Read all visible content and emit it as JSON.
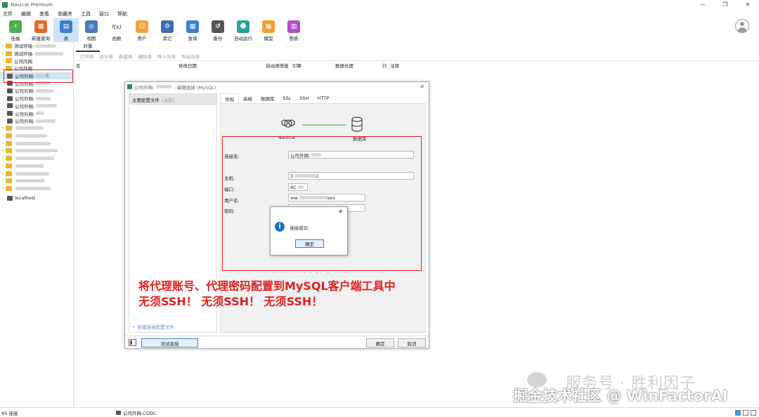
{
  "window": {
    "title": "Navicat Premium",
    "controls": [
      "—",
      "❐",
      "✕"
    ]
  },
  "menu": [
    "文件",
    "编辑",
    "查看",
    "收藏夹",
    "工具",
    "窗口",
    "帮助"
  ],
  "toolbar": [
    {
      "label": "连接",
      "icon": "connect-icon",
      "color": "#4caf50",
      "glyph": "⚡"
    },
    {
      "label": "新建查询",
      "icon": "new-query-icon",
      "color": "#e8682a",
      "glyph": "▦"
    },
    {
      "label": "表",
      "icon": "table-icon",
      "color": "#3b7fd4",
      "glyph": "▤",
      "active": true
    },
    {
      "label": "视图",
      "icon": "view-icon",
      "color": "#4a7ab8",
      "glyph": "◎"
    },
    {
      "label": "函数",
      "icon": "function-icon",
      "color": "#ffffff",
      "glyph": "f(x)"
    },
    {
      "label": "用户",
      "icon": "user-icon",
      "color": "#f2a33a",
      "glyph": "☺"
    },
    {
      "label": "其它",
      "icon": "tools-icon",
      "color": "#3d6fb0",
      "glyph": "⚙"
    },
    {
      "label": "查询",
      "icon": "query-icon",
      "color": "#3b7fd4",
      "glyph": "▦"
    },
    {
      "label": "备份",
      "icon": "backup-icon",
      "color": "#555555",
      "glyph": "↺"
    },
    {
      "label": "自动运行",
      "icon": "robot-icon",
      "color": "#29a19c",
      "glyph": "☻"
    },
    {
      "label": "模型",
      "icon": "model-icon",
      "color": "#f0a030",
      "glyph": "▣"
    },
    {
      "label": "图表",
      "icon": "chart-icon",
      "color": "#b04fc4",
      "glyph": "▥"
    }
  ],
  "sidebar": {
    "items": [
      {
        "label": "测试环境-",
        "type": "folder",
        "blurw": 30
      },
      {
        "label": "测试环境-",
        "type": "folder",
        "blurw": 40
      },
      {
        "label": "公司内网",
        "type": "folder",
        "blurw": 0
      },
      {
        "label": "公司外网",
        "type": "folder",
        "blurw": 0,
        "expanded": true
      },
      {
        "label": "公司外网-",
        "type": "conn",
        "blurw": 0,
        "suffix": "C",
        "selected": true
      },
      {
        "label": "公司外网-",
        "type": "conn",
        "blurw": 20
      },
      {
        "label": "公司外网-",
        "type": "conn",
        "blurw": 25
      },
      {
        "label": "公司外网-",
        "type": "conn",
        "blurw": 22
      },
      {
        "label": "公司外网-",
        "type": "conn",
        "blurw": 30
      },
      {
        "label": "公司外网-",
        "type": "conn",
        "blurw": 12
      },
      {
        "label": "公司外网-",
        "type": "conn",
        "blurw": 28
      },
      {
        "label": "",
        "type": "folder",
        "blurw": 40
      },
      {
        "label": "",
        "type": "folder",
        "blurw": 45
      },
      {
        "label": "",
        "type": "folder",
        "blurw": 50
      },
      {
        "label": "",
        "type": "folder",
        "blurw": 60
      },
      {
        "label": "",
        "type": "folder",
        "blurw": 55
      },
      {
        "label": "",
        "type": "folder",
        "blurw": 40
      },
      {
        "label": "",
        "type": "folder",
        "blurw": 48
      },
      {
        "label": "",
        "type": "folder",
        "blurw": 42
      },
      {
        "label": "",
        "type": "folder",
        "blurw": 50
      },
      {
        "label": "localhost",
        "type": "conn-root",
        "blurw": 0
      }
    ]
  },
  "main": {
    "tab": "对象",
    "objbar": [
      "打开表",
      "设计表",
      "新建表",
      "删除表",
      "导入向导",
      "导出向导"
    ],
    "columns": [
      "名",
      "修改日期",
      "自动递增值",
      "引擎",
      "数据长度",
      "行",
      "注释"
    ]
  },
  "status": {
    "count": "45 连接",
    "conn": "公司外网-CODC"
  },
  "dialog": {
    "title": "公司外网-",
    "title_suffix": "- 编辑连接 (MySQL)",
    "profile": "主要配置文件",
    "profile_sub": "[当前]",
    "new_profile": "+ 新建连接配置文件",
    "tabs": [
      "常规",
      "高级",
      "数据库",
      "SSL",
      "SSH",
      "HTTP"
    ],
    "navicat_label": "Navicat",
    "db_label": "数据库",
    "fields": {
      "conn_name_label": "连接名:",
      "conn_name_value": "公司外网-",
      "host_label": "主机:",
      "host_value": "3",
      "host_value_end": "2",
      "port_label": "端口:",
      "port_value": "6C",
      "user_label": "用户名:",
      "user_value": "ww",
      "user_value_end": "sev",
      "pwd_label": "密码:"
    },
    "test_button": "测试连接",
    "ok_button": "确定",
    "cancel_button": "取消"
  },
  "popup": {
    "message": "连接成功",
    "ok": "确定"
  },
  "annotation": {
    "line1": "将代理账号、代理密码配置到MySQL客户端工具中",
    "line2": "无须SSH！  无须SSH！   无须SSH！"
  },
  "watermark": {
    "line1": "服务号 · 胜利因子",
    "line2": "掘金技术社区 @ WinFactorAI"
  }
}
